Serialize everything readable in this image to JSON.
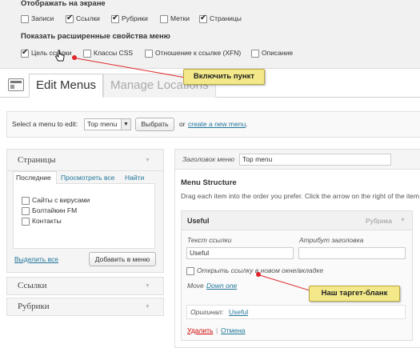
{
  "screen_options": {
    "show_on_screen_title": "Отображать на экране",
    "boxes": [
      {
        "label": "Записи",
        "checked": false
      },
      {
        "label": "Ссылки",
        "checked": true
      },
      {
        "label": "Рубрики",
        "checked": true
      },
      {
        "label": "Метки",
        "checked": false
      },
      {
        "label": "Страницы",
        "checked": true
      }
    ],
    "advanced_title": "Показать расширенные свойства меню",
    "advanced": [
      {
        "label": "Цель ссылки",
        "checked": true
      },
      {
        "label": "Классы CSS",
        "checked": false
      },
      {
        "label": "Отношение к ссылке (XFN)",
        "checked": false
      },
      {
        "label": "Описание",
        "checked": false
      }
    ]
  },
  "tabs": {
    "edit": "Edit Menus",
    "manage": "Manage Locations"
  },
  "select_bar": {
    "label": "Select a menu to edit:",
    "selected": "Top menu",
    "select_button": "Выбрать",
    "or_text": "or",
    "create_link": "create a new menu",
    "period": "."
  },
  "left_panel": {
    "pages_title": "Страницы",
    "tabs": [
      "Последние",
      "Просмотреть все",
      "Найти"
    ],
    "pages": [
      "Сайты с вирусами",
      "Болтайкин FM",
      "Контакты"
    ],
    "select_all": "Выделить все",
    "add_button": "Добавить в меню",
    "links_title": "Ссылки",
    "categories_title": "Рубрики"
  },
  "right_panel": {
    "menu_name_label": "Заголовок меню",
    "menu_name_value": "Top menu",
    "structure_title": "Menu Structure",
    "structure_help": "Drag each item into the order you prefer. Click the arrow on the right of the item",
    "item": {
      "title": "Useful",
      "type": "Рубрика",
      "link_text_label": "Текст ссылки",
      "link_text_value": "Useful",
      "title_attr_label": "Атрибут заголовка",
      "new_window_label": "Открыть ссылку в новом окне/вкладке",
      "move_label": "Move",
      "move_down": "Down one",
      "original_label": "Оригинал:",
      "original_link": "Useful",
      "delete": "Удалить",
      "separator": "|",
      "cancel": "Отмена"
    }
  },
  "callouts": {
    "enable_item": "Включить пункт",
    "target_blank": "Наш таргет-бланк"
  },
  "colors": {
    "link": "#21759b",
    "callout_bg": "#f3e98a",
    "callout_line": "#e0242a",
    "delete": "#cc0000"
  }
}
